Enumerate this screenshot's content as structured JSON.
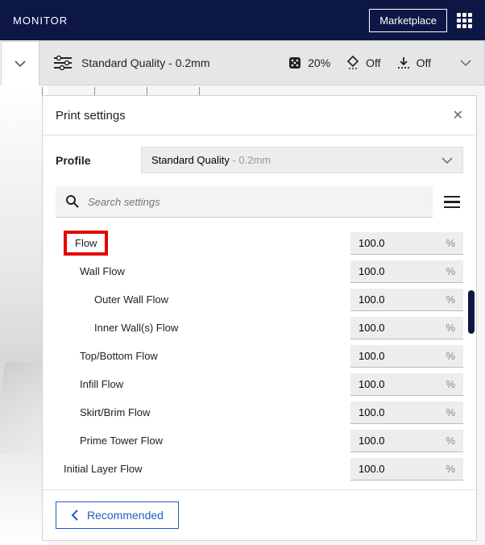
{
  "topbar": {
    "title": "MONITOR",
    "marketplace": "Marketplace"
  },
  "toolbar": {
    "quality": "Standard Quality - 0.2mm",
    "infill": "20%",
    "support": "Off",
    "adhesion": "Off"
  },
  "panel": {
    "title": "Print settings",
    "profile_label": "Profile",
    "profile_name": "Standard Quality",
    "profile_suffix": " - 0.2mm",
    "search_placeholder": "Search settings",
    "recommended": "Recommended"
  },
  "settings": [
    {
      "label": "Flow",
      "value": "100.0",
      "unit": "%",
      "indent": 0,
      "highlight": true
    },
    {
      "label": "Wall Flow",
      "value": "100.0",
      "unit": "%",
      "indent": 1
    },
    {
      "label": "Outer Wall Flow",
      "value": "100.0",
      "unit": "%",
      "indent": 2
    },
    {
      "label": "Inner Wall(s) Flow",
      "value": "100.0",
      "unit": "%",
      "indent": 2
    },
    {
      "label": "Top/Bottom Flow",
      "value": "100.0",
      "unit": "%",
      "indent": 1
    },
    {
      "label": "Infill Flow",
      "value": "100.0",
      "unit": "%",
      "indent": 1
    },
    {
      "label": "Skirt/Brim Flow",
      "value": "100.0",
      "unit": "%",
      "indent": 1
    },
    {
      "label": "Prime Tower Flow",
      "value": "100.0",
      "unit": "%",
      "indent": 1
    },
    {
      "label": "Initial Layer Flow",
      "value": "100.0",
      "unit": "%",
      "indent": 0
    }
  ]
}
